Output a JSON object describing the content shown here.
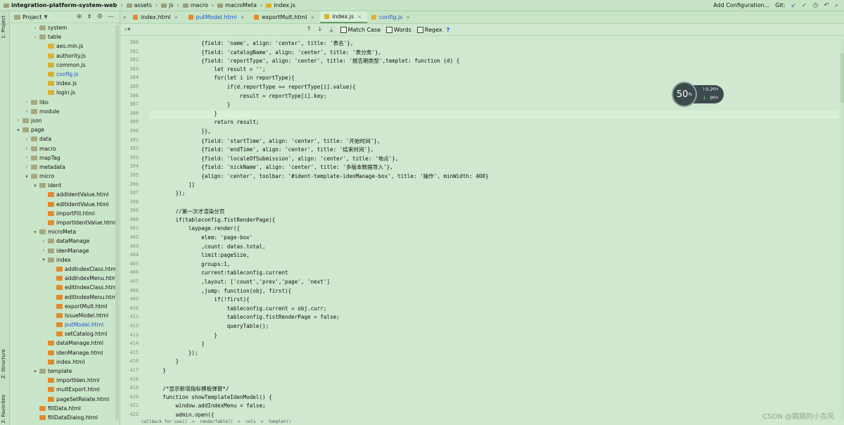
{
  "breadcrumb": [
    "integration-platform-system-web",
    "assets",
    "js",
    "macro",
    "macroMeta",
    "index.js"
  ],
  "topbar": {
    "add_config": "Add Configuration...",
    "git_label": "Git:"
  },
  "sidebar": {
    "tool_windows": [
      "1: Project",
      "Z: Structure",
      "2: Favorites"
    ],
    "panel_title": "Project",
    "items": [
      {
        "label": "system",
        "type": "folder",
        "depth": 3,
        "expand": "closed",
        "highlight": false
      },
      {
        "label": "table",
        "type": "folder",
        "depth": 3,
        "expand": "closed",
        "highlight": false
      },
      {
        "label": "aes.min.js",
        "type": "js",
        "depth": 4,
        "expand": "none",
        "highlight": false
      },
      {
        "label": "authority.js",
        "type": "js",
        "depth": 4,
        "expand": "none",
        "highlight": false
      },
      {
        "label": "common.js",
        "type": "js",
        "depth": 4,
        "expand": "none",
        "highlight": false
      },
      {
        "label": "config.js",
        "type": "js",
        "depth": 4,
        "expand": "none",
        "highlight": true
      },
      {
        "label": "index.js",
        "type": "js",
        "depth": 4,
        "expand": "none",
        "highlight": false
      },
      {
        "label": "login.js",
        "type": "js",
        "depth": 4,
        "expand": "none",
        "highlight": false
      },
      {
        "label": "libs",
        "type": "folder",
        "depth": 2,
        "expand": "closed",
        "highlight": false
      },
      {
        "label": "module",
        "type": "folder",
        "depth": 2,
        "expand": "closed",
        "highlight": false
      },
      {
        "label": "json",
        "type": "folder",
        "depth": 1,
        "expand": "closed",
        "highlight": false
      },
      {
        "label": "page",
        "type": "folder",
        "depth": 1,
        "expand": "open",
        "highlight": false
      },
      {
        "label": "data",
        "type": "folder",
        "depth": 2,
        "expand": "closed",
        "highlight": false
      },
      {
        "label": "macro",
        "type": "folder",
        "depth": 2,
        "expand": "closed",
        "highlight": false
      },
      {
        "label": "mapTag",
        "type": "folder",
        "depth": 2,
        "expand": "closed",
        "highlight": false
      },
      {
        "label": "metadata",
        "type": "folder",
        "depth": 2,
        "expand": "closed",
        "highlight": false
      },
      {
        "label": "micro",
        "type": "folder",
        "depth": 2,
        "expand": "open",
        "highlight": false
      },
      {
        "label": "ident",
        "type": "folder",
        "depth": 3,
        "expand": "open",
        "highlight": false
      },
      {
        "label": "addIdentValue.html",
        "type": "html",
        "depth": 4,
        "expand": "none",
        "highlight": false
      },
      {
        "label": "editIdentValue.html",
        "type": "html",
        "depth": 4,
        "expand": "none",
        "highlight": false
      },
      {
        "label": "importFill.html",
        "type": "html",
        "depth": 4,
        "expand": "none",
        "highlight": false
      },
      {
        "label": "importIdentValue.html",
        "type": "html",
        "depth": 4,
        "expand": "none",
        "highlight": false
      },
      {
        "label": "microMeta",
        "type": "folder",
        "depth": 3,
        "expand": "open",
        "highlight": false
      },
      {
        "label": "dataManage",
        "type": "folder",
        "depth": 4,
        "expand": "closed",
        "highlight": false
      },
      {
        "label": "idenManage",
        "type": "folder",
        "depth": 4,
        "expand": "closed",
        "highlight": false
      },
      {
        "label": "index",
        "type": "folder",
        "depth": 4,
        "expand": "open",
        "highlight": false
      },
      {
        "label": "addIndexClass.html",
        "type": "html",
        "depth": 5,
        "expand": "none",
        "highlight": false
      },
      {
        "label": "addIndexMenu.htm",
        "type": "html",
        "depth": 5,
        "expand": "none",
        "highlight": false
      },
      {
        "label": "editIndexClass.htm",
        "type": "html",
        "depth": 5,
        "expand": "none",
        "highlight": false
      },
      {
        "label": "editIndexMenu.htm",
        "type": "html",
        "depth": 5,
        "expand": "none",
        "highlight": false
      },
      {
        "label": "exportMult.html",
        "type": "html",
        "depth": 5,
        "expand": "none",
        "highlight": false
      },
      {
        "label": "IssueModel.html",
        "type": "html",
        "depth": 5,
        "expand": "none",
        "highlight": false
      },
      {
        "label": "putModel.html",
        "type": "html",
        "depth": 5,
        "expand": "none",
        "highlight": true
      },
      {
        "label": "setCatalog.html",
        "type": "html",
        "depth": 5,
        "expand": "none",
        "highlight": false
      },
      {
        "label": "dataManage.html",
        "type": "html",
        "depth": 4,
        "expand": "none",
        "highlight": false
      },
      {
        "label": "idenManage.html",
        "type": "html",
        "depth": 4,
        "expand": "none",
        "highlight": false
      },
      {
        "label": "index.html",
        "type": "html",
        "depth": 4,
        "expand": "none",
        "highlight": false
      },
      {
        "label": "template",
        "type": "folder",
        "depth": 3,
        "expand": "open",
        "highlight": false
      },
      {
        "label": "importIden.html",
        "type": "html",
        "depth": 4,
        "expand": "none",
        "highlight": false
      },
      {
        "label": "multExport.html",
        "type": "html",
        "depth": 4,
        "expand": "none",
        "highlight": false
      },
      {
        "label": "pageSetRelate.html",
        "type": "html",
        "depth": 4,
        "expand": "none",
        "highlight": false
      },
      {
        "label": "fillData.html",
        "type": "html",
        "depth": 3,
        "expand": "none",
        "highlight": false
      },
      {
        "label": "fillDataDialog.html",
        "type": "html",
        "depth": 3,
        "expand": "none",
        "highlight": false
      }
    ]
  },
  "tabs": [
    {
      "label": "index.html",
      "type": "html",
      "active": false,
      "highlight": false
    },
    {
      "label": "putModel.html",
      "type": "html",
      "active": false,
      "highlight": true
    },
    {
      "label": "exportMult.html",
      "type": "html",
      "active": false,
      "highlight": false
    },
    {
      "label": "index.js",
      "type": "js",
      "active": true,
      "highlight": false
    },
    {
      "label": "config.js",
      "type": "js",
      "active": false,
      "highlight": true
    }
  ],
  "search": {
    "match_case": "Match Case",
    "words": "Words",
    "regex": "Regex",
    "help": "?"
  },
  "code": {
    "first_line": 380,
    "current_line": 388,
    "lines": [
      "                {field: 'name', align: 'center', title: '表名'},",
      "                {field: 'catalogName', align: 'center', title: '表分类'},",
      "                {field: 'reportType', align: 'center', title: '报告期类型',templet: function (d) {",
      "                    let result = '';",
      "                    for(let i in reportType){",
      "                        if(d.reportType == reportType[i].value){",
      "                            result = reportType[i].key;",
      "                        }",
      "                    }",
      "                    return result;",
      "                }},",
      "                {field: 'startTime', align: 'center', title: '开始时间'},",
      "                {field: 'endTime', align: 'center', title: '结束时间'},",
      "                {field: 'localeOfSubmission', align: 'center', title: '地点'},",
      "                {field: 'nickName', align: 'center', title: '多版本数据导入'},",
      "                {align: 'center', toolbar: '#ident-template-idenManage-box', title: '操作', minWidth: 400}",
      "            ]]",
      "        });",
      "",
      "        //第一次才渲染分页",
      "        if(tableconfig.fistRenderPage){",
      "            laypage.render({",
      "                elem: 'page-box'",
      "                ,count: datas.total,",
      "                limit:pageSize,",
      "                groups:1,",
      "                current:tableconfig.current",
      "                ,layout: ['count','prev','page', 'next']",
      "                ,jump: function(obj, first){",
      "                    if(!first){",
      "                        tableconfig.current = obj.curr;",
      "                        tableconfig.fistRenderPage = false;",
      "                        queryTable();",
      "                    }",
      "                }",
      "            });",
      "        }",
      "    }",
      "",
      "    /*显示新增指标模板弹窗*/",
      "    function showTemplateIdenModel() {",
      "        window.addIndexMenu = false;",
      "        admin.open({"
    ],
    "status_path": "callback for use()  >  renderTable()  >  cols  >  templet()"
  },
  "widget": {
    "percent": "50",
    "percent_sign": "%",
    "up_speed": "0.2",
    "up_unit": "K/s",
    "down_speed": "0",
    "down_unit": "K/s"
  },
  "watermark": "CSDN @跳跳的小古风"
}
